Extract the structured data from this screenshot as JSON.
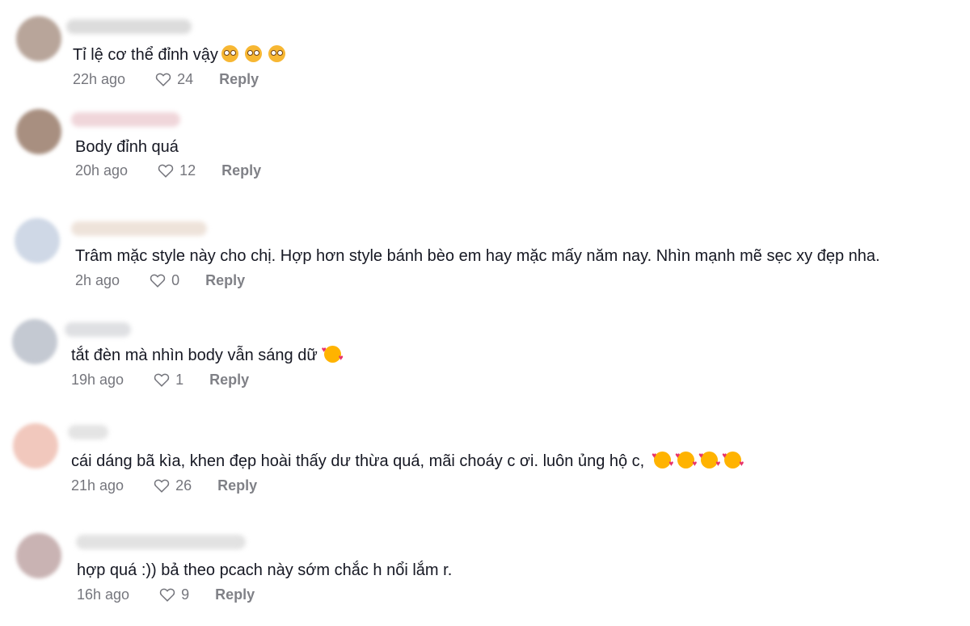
{
  "comments": [
    {
      "text": "Tỉ lệ cơ thể đỉnh vậy",
      "emoji_name": "flushed-face-icon",
      "emoji_count": 3,
      "time": "22h ago",
      "likes": "24",
      "reply_label": "Reply",
      "avatar_color": "#b8a59a",
      "username_color": "#dcdcdc"
    },
    {
      "text": "Body đỉnh quá",
      "emoji_name": "",
      "emoji_count": 0,
      "time": "20h ago",
      "likes": "12",
      "reply_label": "Reply",
      "avatar_color": "#a88f80",
      "username_color": "#f0d6da"
    },
    {
      "text": "Trâm mặc style này cho chị. Hợp hơn style bánh bèo em hay mặc mấy năm nay. Nhìn mạnh mẽ sẹc xy đẹp nha.",
      "emoji_name": "",
      "emoji_count": 0,
      "time": "2h ago",
      "likes": "0",
      "reply_label": "Reply",
      "avatar_color": "#cfd8e6",
      "username_color": "#eee3da"
    },
    {
      "text": "tắt đèn mà nhìn body vẫn sáng dữ",
      "emoji_name": "smiling-face-with-hearts-icon",
      "emoji_count": 1,
      "time": "19h ago",
      "likes": "1",
      "reply_label": "Reply",
      "avatar_color": "#c4c9d2",
      "username_color": "#dfe0e3"
    },
    {
      "text": "cái dáng bã kìa, khen đẹp hoài thấy dư thừa quá, mãi choáy c ơi. luôn ủng hộ c,",
      "emoji_name": "smiling-face-with-hearts-icon",
      "emoji_count": 4,
      "time": "21h ago",
      "likes": "26",
      "reply_label": "Reply",
      "avatar_color": "#f1c8bd",
      "username_color": "#e4e4e4"
    },
    {
      "text": "hợp quá :)) bả theo pcach này sớm chắc h nổi lắm r.",
      "emoji_name": "",
      "emoji_count": 0,
      "time": "16h ago",
      "likes": "9",
      "reply_label": "Reply",
      "avatar_color": "#c9b3b3",
      "username_color": "#e2e2e2"
    }
  ]
}
